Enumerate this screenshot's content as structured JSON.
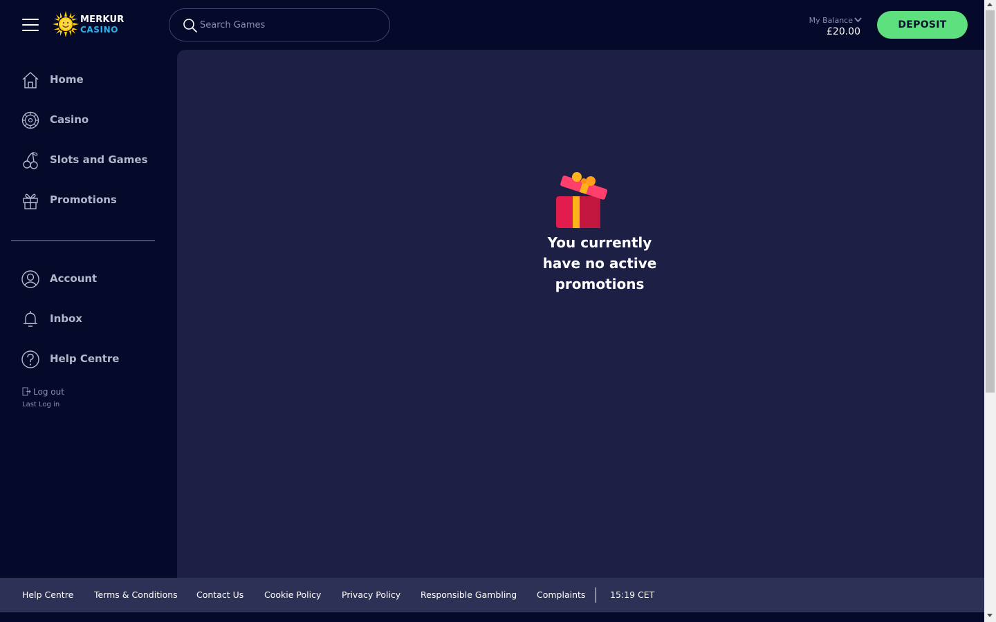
{
  "header": {
    "logo": {
      "line1": "MERKUR",
      "line2": "CASINO"
    },
    "search": {
      "placeholder": "Search Games"
    },
    "balance": {
      "label": "My Balance",
      "value": "£20.00"
    },
    "deposit_label": "DEPOSIT"
  },
  "sidebar": {
    "primary": [
      {
        "label": "Home",
        "icon": "home-icon"
      },
      {
        "label": "Casino",
        "icon": "roulette-icon"
      },
      {
        "label": "Slots and Games",
        "icon": "cherries-icon"
      },
      {
        "label": "Promotions",
        "icon": "gift-icon"
      }
    ],
    "secondary": [
      {
        "label": "Account",
        "icon": "user-icon"
      },
      {
        "label": "Inbox",
        "icon": "bell-icon"
      },
      {
        "label": "Help Centre",
        "icon": "question-icon"
      }
    ],
    "logout_label": "Log out",
    "last_login_label": "Last Log in"
  },
  "main": {
    "empty_message": [
      "You currently",
      "have no active",
      "promotions"
    ]
  },
  "footer": {
    "links": [
      "Help Centre",
      "Terms & Conditions",
      "Contact Us",
      "Cookie Policy",
      "Privacy Policy",
      "Responsible Gambling",
      "Complaints"
    ],
    "time": "15:19 CET"
  },
  "colors": {
    "background": "#050a2a",
    "main_panel": "#1d1f45",
    "footer": "#2e3156",
    "deposit_button": "#5ee07e",
    "logo_accent": "#2bb3f0"
  }
}
